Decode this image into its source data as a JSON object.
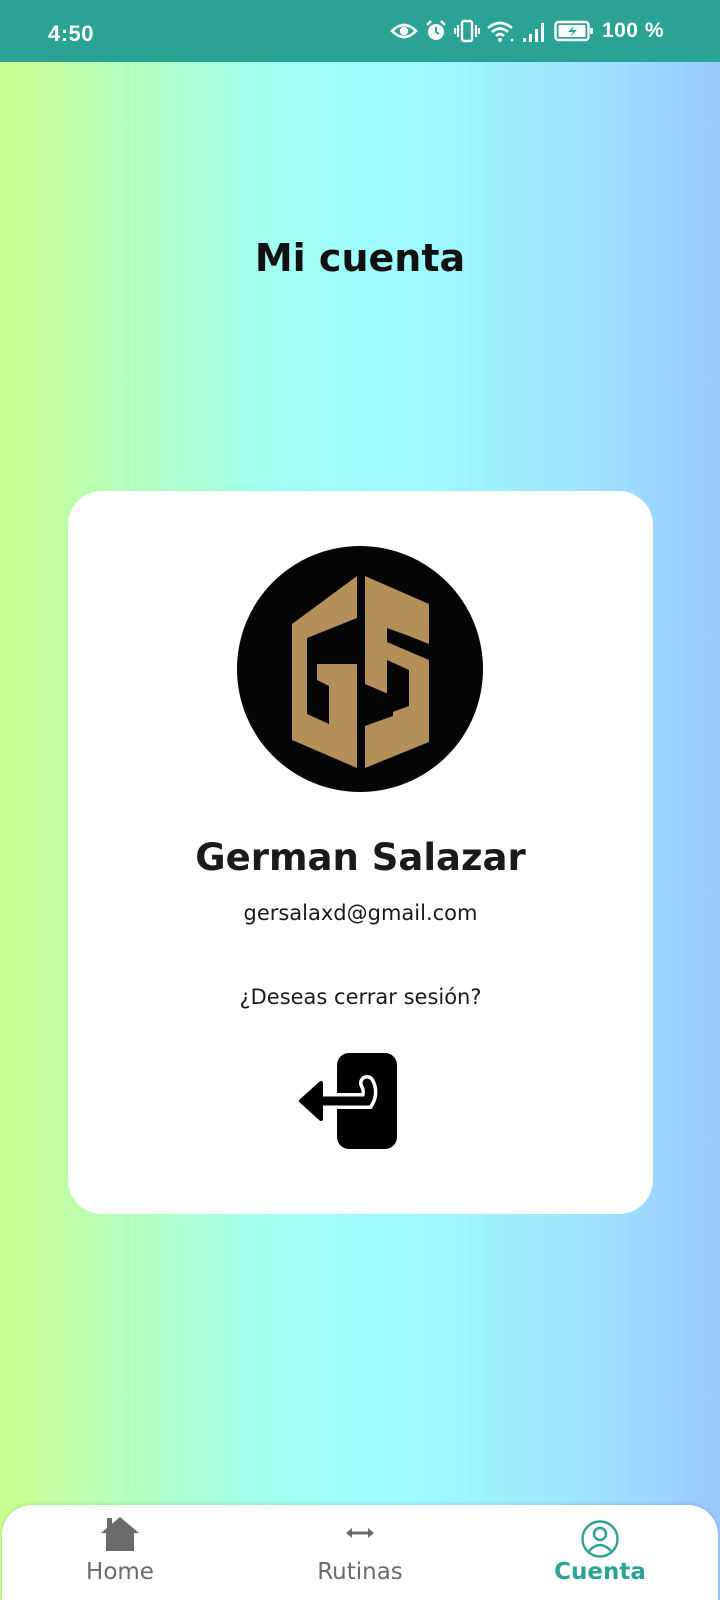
{
  "status_bar": {
    "time": "4:50",
    "battery_text": "100 %",
    "icons": [
      "eye-icon",
      "alarm-icon",
      "vibrate-icon",
      "wifi-icon",
      "signal-icon",
      "battery-icon"
    ],
    "background": "#2aa394"
  },
  "page": {
    "title": "Mi cuenta"
  },
  "profile": {
    "avatar_monogram": "GS",
    "avatar_colors": {
      "background": "#050505",
      "letters": "#b48f5a"
    },
    "name": "German Salazar",
    "email": "gersalaxd@gmail.com",
    "logout_prompt": "¿Deseas cerrar sesión?",
    "logout_icon": "logout-icon"
  },
  "bottom_nav": {
    "items": [
      {
        "label": "Home",
        "icon": "home-icon",
        "active": false
      },
      {
        "label": "Rutinas",
        "icon": "dumbbell-icon",
        "active": false
      },
      {
        "label": "Cuenta",
        "icon": "account-icon",
        "active": true
      }
    ],
    "active_color": "#2aa394",
    "inactive_color": "#6b6b6b"
  }
}
